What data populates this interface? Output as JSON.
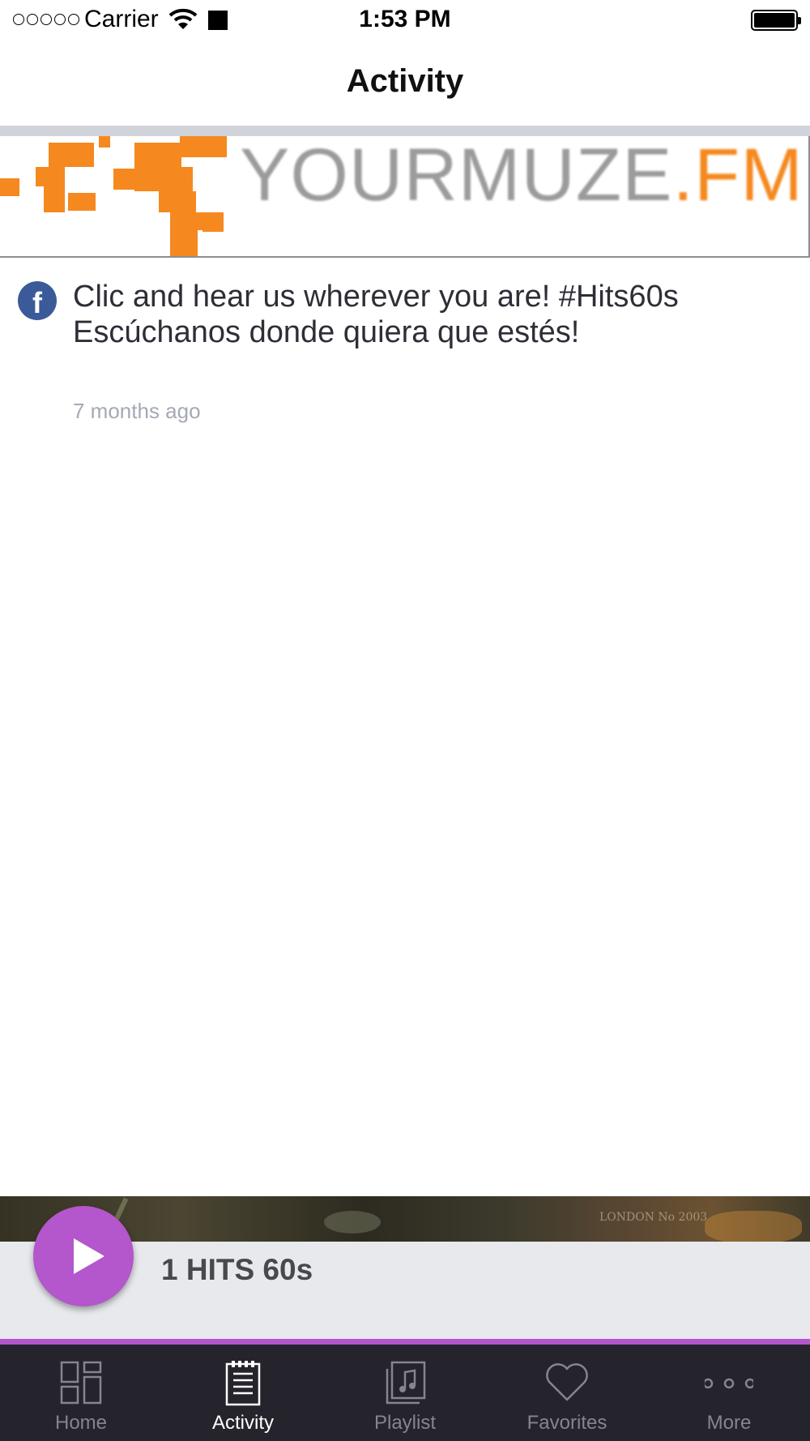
{
  "status_bar": {
    "carrier": "Carrier",
    "time": "1:53 PM"
  },
  "nav": {
    "title": "Activity"
  },
  "banner": {
    "brand_main": "YOURMUZE",
    "brand_suffix": ".FM",
    "brand_color": "#f5891f"
  },
  "feed": {
    "items": [
      {
        "source_icon": "facebook-icon",
        "text_line1": "Clic and hear us wherever you are! #Hits60s",
        "text_line2": "Escúchanos donde quiera que estés!",
        "time": "7 months ago"
      }
    ]
  },
  "player": {
    "station": "1 HITS 60s",
    "accent": "#b456cc"
  },
  "tabs": [
    {
      "label": "Home",
      "icon": "grid-icon",
      "active": false
    },
    {
      "label": "Activity",
      "icon": "notepad-icon",
      "active": true
    },
    {
      "label": "Playlist",
      "icon": "music-note-icon",
      "active": false
    },
    {
      "label": "Favorites",
      "icon": "heart-icon",
      "active": false
    },
    {
      "label": "More",
      "icon": "more-dots-icon",
      "active": false
    }
  ]
}
